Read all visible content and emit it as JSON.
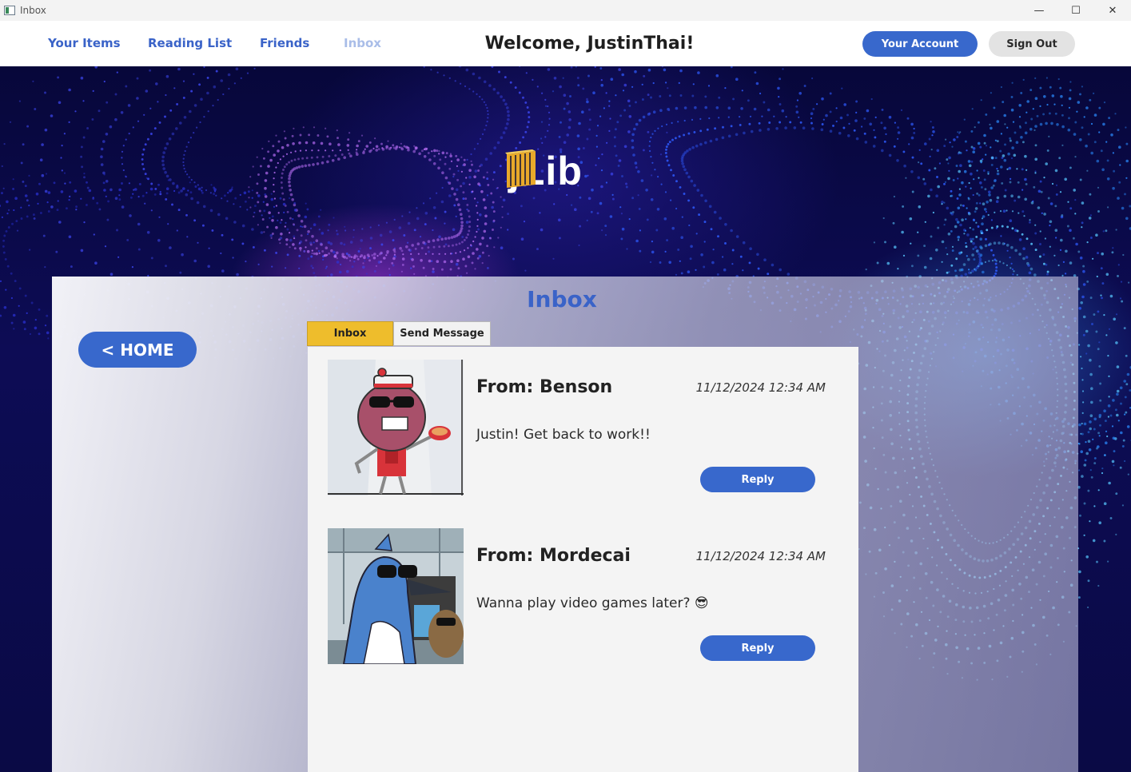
{
  "window": {
    "title": "Inbox",
    "controls": {
      "minimize": "—",
      "maximize": "☐",
      "close": "✕"
    }
  },
  "nav": {
    "items": [
      {
        "label": "Your Items"
      },
      {
        "label": "Reading List"
      },
      {
        "label": "Friends"
      },
      {
        "label": "Inbox"
      }
    ],
    "welcome": "Welcome, JustinThai!",
    "account_label": "Your Account",
    "signout_label": "Sign Out"
  },
  "logo": {
    "text": "jLib"
  },
  "panel": {
    "title": "Inbox",
    "home_label": "< HOME",
    "tabs": [
      {
        "label": "Inbox"
      },
      {
        "label": "Send Message"
      }
    ]
  },
  "messages": [
    {
      "from": "From: Benson",
      "date": "11/12/2024 12:34 AM",
      "body": "Justin! Get back to work!!",
      "reply_label": "Reply",
      "avatar_icon": "benson-avatar"
    },
    {
      "from": "From: Mordecai",
      "date": "11/12/2024 12:34 AM",
      "body": "Wanna play video games later? 😎",
      "reply_label": "Reply",
      "avatar_icon": "mordecai-avatar"
    }
  ],
  "colors": {
    "accent": "#3868cc",
    "link": "#3a63c8",
    "active_tab": "#eebd2c",
    "disabled_link": "#a9bde8"
  }
}
